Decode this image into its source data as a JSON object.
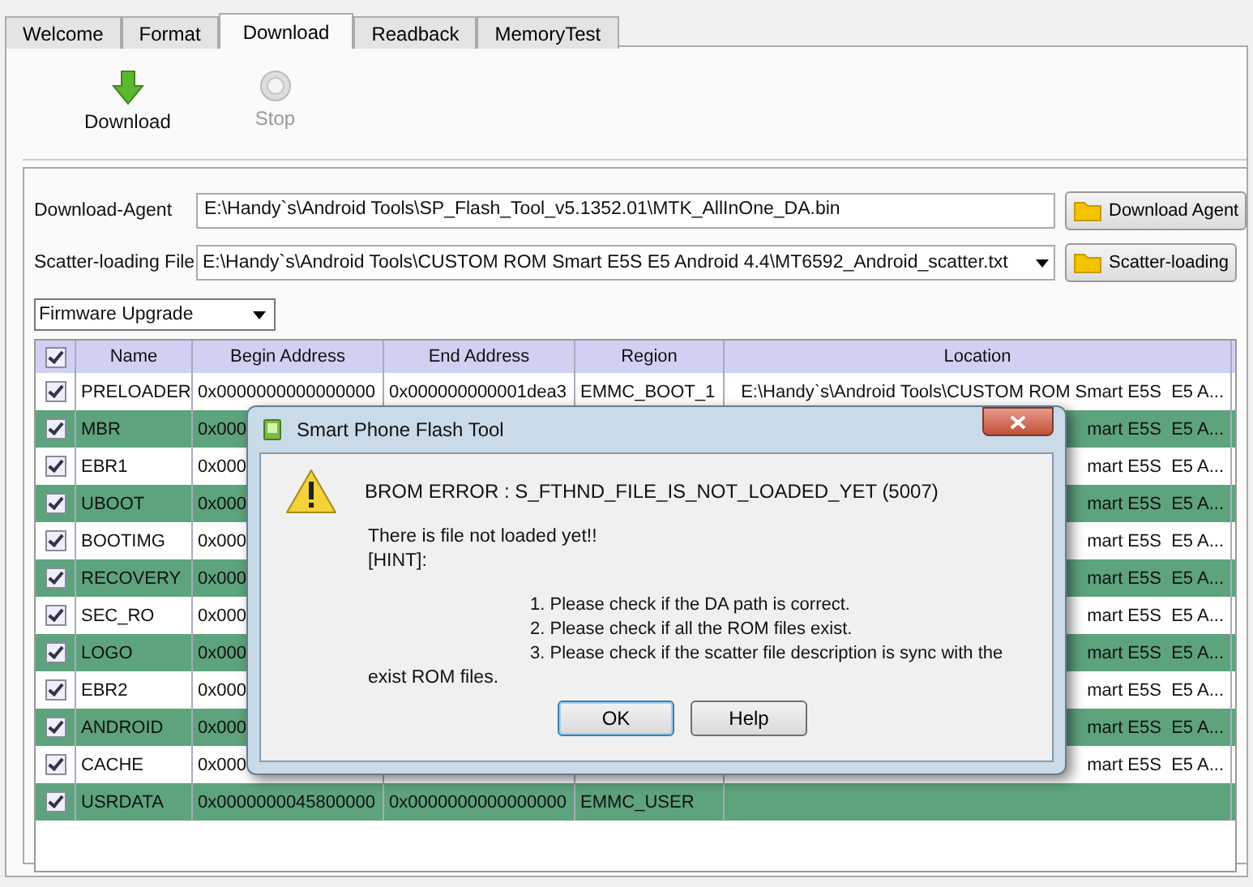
{
  "tabs": [
    {
      "label": "Welcome",
      "selected": false
    },
    {
      "label": "Format",
      "selected": false
    },
    {
      "label": "Download",
      "selected": true
    },
    {
      "label": "Readback",
      "selected": false
    },
    {
      "label": "MemoryTest",
      "selected": false
    }
  ],
  "toolbar": [
    {
      "kind": "download",
      "label": "Download",
      "disabled": false
    },
    {
      "kind": "stop",
      "label": "Stop",
      "disabled": true
    }
  ],
  "download_agent": {
    "label": "Download-Agent",
    "value": "E:\\Handy`s\\Android Tools\\SP_Flash_Tool_v5.1352.01\\MTK_AllInOne_DA.bin",
    "button": "Download Agent"
  },
  "scatter_file": {
    "label": "Scatter-loading File",
    "value": "E:\\Handy`s\\Android Tools\\CUSTOM ROM Smart E5S  E5 Android 4.4\\MT6592_Android_scatter.txt",
    "button": "Scatter-loading"
  },
  "mode_select": {
    "value": "Firmware Upgrade"
  },
  "table": {
    "all_checked": true,
    "columns": [
      "Name",
      "Begin Address",
      "End Address",
      "Region",
      "Location"
    ],
    "rows": [
      {
        "checked": true,
        "name": "PRELOADER",
        "begin": "0x0000000000000000",
        "end": "0x000000000001dea3",
        "region": "EMMC_BOOT_1",
        "location": "E:\\Handy`s\\Android Tools\\CUSTOM ROM Smart E5S  E5 A..."
      },
      {
        "checked": true,
        "name": "MBR",
        "begin": "0x000",
        "location": "mart E5S  E5 A..."
      },
      {
        "checked": true,
        "name": "EBR1",
        "begin": "0x000",
        "location": "mart E5S  E5 A..."
      },
      {
        "checked": true,
        "name": "UBOOT",
        "begin": "0x000",
        "location": "mart E5S  E5 A..."
      },
      {
        "checked": true,
        "name": "BOOTIMG",
        "begin": "0x000",
        "location": "mart E5S  E5 A..."
      },
      {
        "checked": true,
        "name": "RECOVERY",
        "begin": "0x000",
        "location": "mart E5S  E5 A..."
      },
      {
        "checked": true,
        "name": "SEC_RO",
        "begin": "0x000",
        "location": "mart E5S  E5 A..."
      },
      {
        "checked": true,
        "name": "LOGO",
        "begin": "0x000",
        "location": "mart E5S  E5 A..."
      },
      {
        "checked": true,
        "name": "EBR2",
        "begin": "0x000",
        "location": "mart E5S  E5 A..."
      },
      {
        "checked": true,
        "name": "ANDROID",
        "begin": "0x000",
        "location": "mart E5S  E5 A..."
      },
      {
        "checked": true,
        "name": "CACHE",
        "begin": "0x000",
        "location": "mart E5S  E5 A..."
      },
      {
        "checked": true,
        "name": "USRDATA",
        "begin": "0x0000000045800000",
        "end": "0x0000000000000000",
        "region": "EMMC_USER"
      }
    ]
  },
  "dialog": {
    "title": "Smart Phone Flash Tool",
    "error": "BROM ERROR : S_FTHND_FILE_IS_NOT_LOADED_YET (5007)",
    "lines": [
      "There is file not loaded yet!!",
      "[HINT]:"
    ],
    "hints": [
      "1. Please check if the DA path is correct.",
      "2. Please check if all the ROM files exist.",
      "3. Please check if the scatter file description is sync with the"
    ],
    "continuation": "exist ROM files.",
    "buttons": [
      "OK",
      "Help"
    ]
  }
}
